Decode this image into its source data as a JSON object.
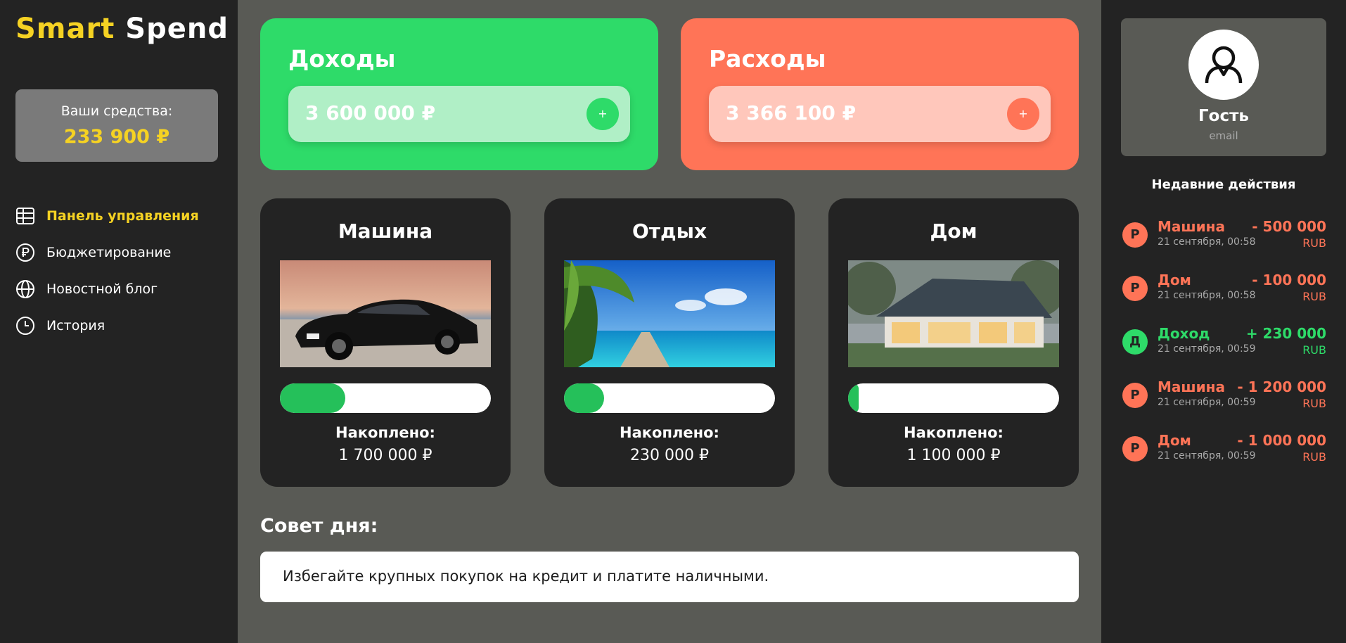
{
  "brand": {
    "part1": "Smart",
    "part2": "Spend"
  },
  "funds": {
    "label": "Ваши средства:",
    "value": "233 900 ₽"
  },
  "nav": [
    {
      "label": "Панель управления",
      "icon": "dashboard-grid-icon",
      "active": true
    },
    {
      "label": "Бюджетирование",
      "icon": "ruble-circle-icon",
      "active": false
    },
    {
      "label": "Новостной блог",
      "icon": "globe-icon",
      "active": false
    },
    {
      "label": "История",
      "icon": "clock-icon",
      "active": false
    }
  ],
  "income": {
    "title": "Доходы",
    "amount": "3 600 000 ₽",
    "add_label": "+"
  },
  "expenses": {
    "title": "Расходы",
    "amount": "3 366 100 ₽",
    "add_label": "+"
  },
  "goals": [
    {
      "title": "Машина",
      "image": "car-photo",
      "progress": 0.31,
      "saved_label": "Накоплено:",
      "saved_value": "1 700 000 ₽"
    },
    {
      "title": "Отдых",
      "image": "beach-photo",
      "progress": 0.19,
      "saved_label": "Накоплено:",
      "saved_value": "230 000 ₽"
    },
    {
      "title": "Дом",
      "image": "house-photo",
      "progress": 0.05,
      "saved_label": "Накоплено:",
      "saved_value": "1 100 000 ₽"
    }
  ],
  "tip": {
    "title": "Совет дня:",
    "text": "Избегайте крупных покупок на кредит и платите наличными."
  },
  "profile": {
    "name": "Гость",
    "email": "email",
    "avatar_icon": "user-icon"
  },
  "recent": {
    "title": "Недавние действия",
    "items": [
      {
        "badge": "Р",
        "name": "Машина",
        "date": "21 сентября, 00:58",
        "amount": "- 500 000",
        "currency": "RUB",
        "kind": "expense"
      },
      {
        "badge": "Р",
        "name": "Дом",
        "date": "21 сентября, 00:58",
        "amount": "- 100 000",
        "currency": "RUB",
        "kind": "expense"
      },
      {
        "badge": "Д",
        "name": "Доход",
        "date": "21 сентября, 00:59",
        "amount": "+ 230 000",
        "currency": "RUB",
        "kind": "income"
      },
      {
        "badge": "Р",
        "name": "Машина",
        "date": "21 сентября, 00:59",
        "amount": "- 1 200 000",
        "currency": "RUB",
        "kind": "expense"
      },
      {
        "badge": "Р",
        "name": "Дом",
        "date": "21 сентября, 00:59",
        "amount": "- 1 000 000",
        "currency": "RUB",
        "kind": "expense"
      }
    ]
  },
  "colors": {
    "accent_yellow": "#f5d223",
    "income_green": "#2edb69",
    "expense_red": "#ff7457",
    "progress_green": "#25c05a",
    "panel_dark": "#232323",
    "background": "#595a55"
  }
}
